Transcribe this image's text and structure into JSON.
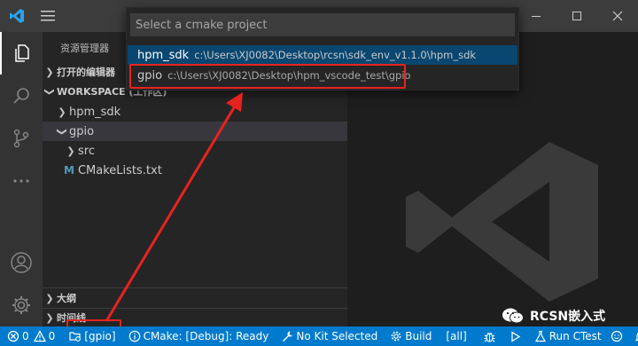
{
  "sidebar": {
    "title": "资源管理器",
    "open_editors": "打开的编辑器",
    "workspace": "WORKSPACE (工作区)",
    "tree": [
      {
        "label": "hpm_sdk"
      },
      {
        "label": "gpio"
      },
      {
        "label": "src"
      },
      {
        "label": "CMakeLists.txt"
      }
    ],
    "outline": "大纲",
    "timeline": "时间线"
  },
  "quickpick": {
    "placeholder": "Select a cmake project",
    "items": [
      {
        "label": "hpm_sdk",
        "description": "c:\\Users\\XJ0082\\Desktop\\rcsn\\sdk_env_v1.1.0\\hpm_sdk"
      },
      {
        "label": "gpio",
        "description": "c:\\Users\\XJ0082\\Desktop\\hpm_vscode_test\\gpio"
      }
    ]
  },
  "statusbar": {
    "errors": "0",
    "warnings": "0",
    "project": "[gpio]",
    "cmake_status": "CMake: [Debug]: Ready",
    "kit": "No Kit Selected",
    "build": "Build",
    "target": "[all]",
    "run_ctest": "Run CTest"
  },
  "watermark": {
    "brand": "RCSN嵌入式"
  },
  "colors": {
    "accent": "#007acc",
    "selection": "#094771",
    "annotation": "#e8231e"
  }
}
